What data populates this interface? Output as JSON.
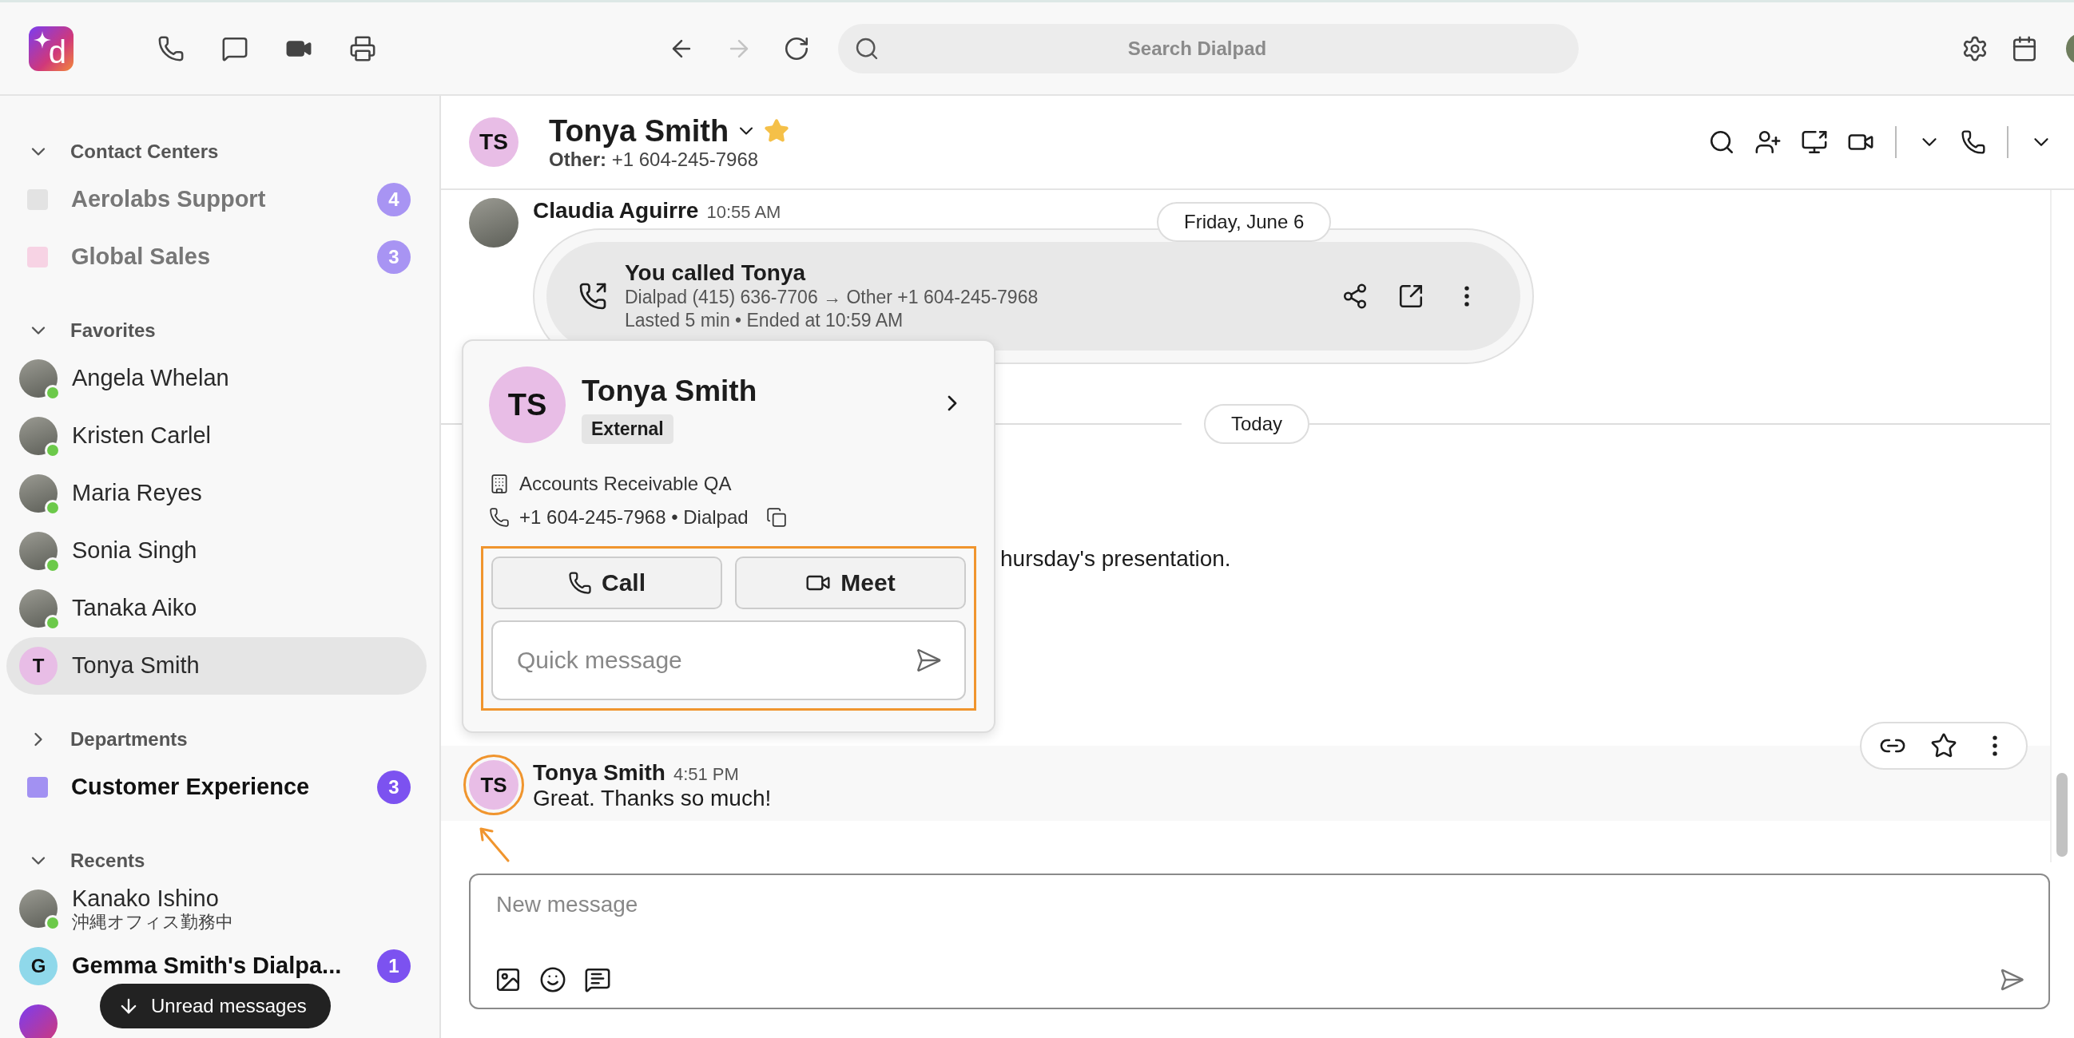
{
  "app_logo": "d",
  "top_bar": {
    "forward_disabled": true,
    "search": {
      "placeholder": "Search Dialpad"
    }
  },
  "sidebar": {
    "sections": [
      {
        "title": "Contact Centers",
        "expanded": true,
        "items": [
          {
            "kind": "channel",
            "label": "Aerolabs Support",
            "color": "#e3e3e3",
            "muted": true,
            "unread": false,
            "badge": "4",
            "selected": false
          },
          {
            "kind": "channel",
            "label": "Global Sales",
            "color": "#f7d3e4",
            "muted": true,
            "unread": false,
            "badge": "3",
            "selected": false
          }
        ]
      },
      {
        "title": "Favorites",
        "expanded": true,
        "items": [
          {
            "kind": "person",
            "label": "Angela Whelan",
            "online": true,
            "selected": false
          },
          {
            "kind": "person",
            "label": "Kristen Carlel",
            "online": true,
            "selected": false
          },
          {
            "kind": "person",
            "label": "Maria Reyes",
            "online": true,
            "selected": false
          },
          {
            "kind": "person",
            "label": "Sonia Singh",
            "online": true,
            "selected": false
          },
          {
            "kind": "person",
            "label": "Tanaka Aiko",
            "online": true,
            "selected": false
          },
          {
            "kind": "initials",
            "label": "Tonya Smith",
            "initials": "T",
            "color": "#e8bde6",
            "selected": true
          }
        ]
      },
      {
        "title": "Departments",
        "expanded": false,
        "items": [
          {
            "kind": "channel",
            "label": "Customer Experience",
            "color": "#a291f2",
            "muted": false,
            "unread": true,
            "badge": "3",
            "selected": false
          }
        ]
      },
      {
        "title": "Recents",
        "expanded": true,
        "items": [
          {
            "kind": "person",
            "label": "Kanako Ishino",
            "subtitle": "沖縄オフィス勤務中",
            "online": true,
            "selected": false
          },
          {
            "kind": "initials",
            "label": "Gemma Smith's Dialpa...",
            "initials": "G",
            "color": "#8fd8ea",
            "unread": true,
            "badge": "1",
            "selected": false
          },
          {
            "kind": "bot",
            "selected": false
          }
        ]
      }
    ],
    "toast": "Unread messages"
  },
  "chat": {
    "header": {
      "initials": "TS",
      "name": "Tonya Smith",
      "favorite": true,
      "subtitle": "**Other:** +1 604-245-7968"
    },
    "sticky_date": "Friday, June 6",
    "messages": [
      {
        "kind": "call",
        "author": "Claudia Aguirre",
        "time": "10:55 AM",
        "title": "You called Tonya",
        "detail": "Dialpad (415) 636-7706 → Other +1 604-245-7968",
        "meta": "Lasted 5 min • Ended at 10:59 AM"
      },
      {
        "kind": "separator",
        "label": "Today"
      },
      {
        "kind": "fragment",
        "text": "hursday's presentation."
      },
      {
        "kind": "message",
        "author": "Tonya Smith",
        "initials": "TS",
        "time": "4:51 PM",
        "text": "Great. Thanks so much!",
        "highlighted": true
      }
    ],
    "composer": {
      "placeholder": "New message"
    }
  },
  "popup": {
    "initials": "TS",
    "name": "Tonya Smith",
    "tag": "External",
    "company": "Accounts Receivable QA",
    "phone_line": "+1 604-245-7968 • Dialpad",
    "actions": [
      {
        "kind": "call",
        "label": "Call"
      },
      {
        "kind": "meet",
        "label": "Meet"
      }
    ],
    "quick_message": {
      "placeholder": "Quick message"
    },
    "highlighted": true
  }
}
